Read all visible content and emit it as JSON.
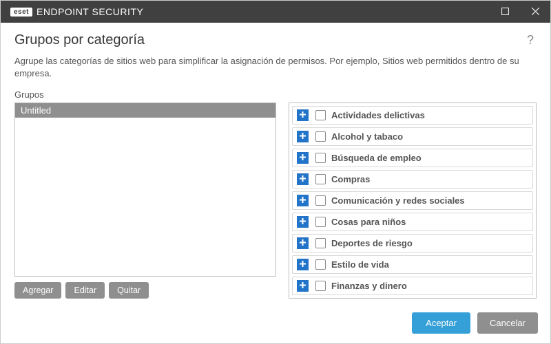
{
  "titlebar": {
    "brand_box": "eset",
    "brand_text": "ENDPOINT SECURITY"
  },
  "heading": "Grupos por categoría",
  "help_symbol": "?",
  "description": "Agrupe las categorías de sitios web para simplificar la asignación de permisos. Por ejemplo, Sitios web permitidos dentro de su empresa.",
  "groups": {
    "label": "Grupos",
    "items": [
      {
        "name": "Untitled",
        "selected": true
      }
    ],
    "buttons": {
      "add": "Agregar",
      "edit": "Editar",
      "remove": "Quitar"
    }
  },
  "categories": [
    {
      "label": "Actividades delictivas",
      "checked": false
    },
    {
      "label": "Alcohol y tabaco",
      "checked": false
    },
    {
      "label": "Búsqueda de empleo",
      "checked": false
    },
    {
      "label": "Compras",
      "checked": false
    },
    {
      "label": "Comunicación y redes sociales",
      "checked": false
    },
    {
      "label": "Cosas para niños",
      "checked": false
    },
    {
      "label": "Deportes de riesgo",
      "checked": false
    },
    {
      "label": "Estilo de vida",
      "checked": false
    },
    {
      "label": "Finanzas y dinero",
      "checked": false
    }
  ],
  "footer": {
    "ok": "Aceptar",
    "cancel": "Cancelar"
  }
}
